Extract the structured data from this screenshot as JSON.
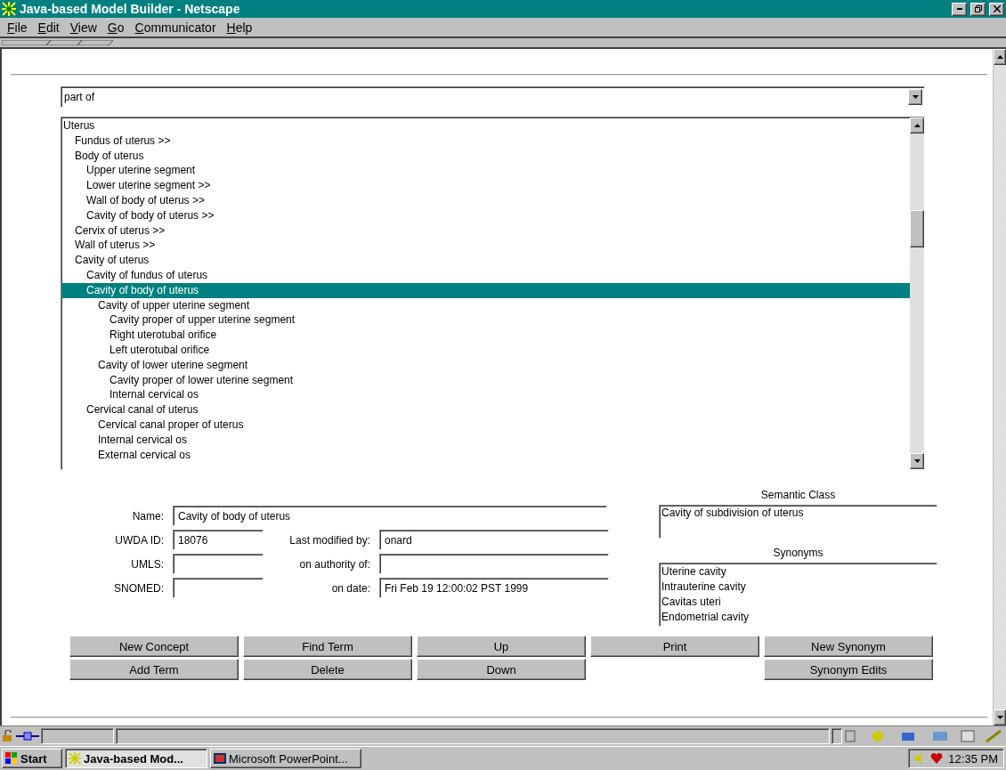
{
  "window": {
    "title": "Java-based Model Builder - Netscape"
  },
  "menu": [
    "File",
    "Edit",
    "View",
    "Go",
    "Communicator",
    "Help"
  ],
  "relation": {
    "value": "part of"
  },
  "tree": [
    {
      "label": "Uterus",
      "selected": false,
      "children": [
        {
          "label": "Fundus of uterus >>",
          "selected": false
        },
        {
          "label": "Body of uterus",
          "selected": false,
          "children": [
            {
              "label": "Upper uterine segment",
              "selected": false
            },
            {
              "label": "Lower uterine segment >>",
              "selected": false
            },
            {
              "label": "Wall of body of uterus >>",
              "selected": false
            },
            {
              "label": "Cavity of body of uterus >>",
              "selected": false
            }
          ]
        },
        {
          "label": "Cervix of uterus >>",
          "selected": false
        },
        {
          "label": "Wall of uterus >>",
          "selected": false
        },
        {
          "label": "Cavity of uterus",
          "selected": false,
          "children": [
            {
              "label": "Cavity of fundus of uterus",
              "selected": false
            },
            {
              "label": "Cavity of body of uterus",
              "selected": true,
              "children": [
                {
                  "label": "Cavity of upper uterine segment",
                  "selected": false,
                  "children": [
                    {
                      "label": "Cavity proper of upper uterine segment",
                      "selected": false
                    },
                    {
                      "label": "Right uterotubal orifice",
                      "selected": false
                    },
                    {
                      "label": "Left uterotubal orifice",
                      "selected": false
                    }
                  ]
                },
                {
                  "label": "Cavity of lower uterine segment",
                  "selected": false,
                  "children": [
                    {
                      "label": "Cavity proper of lower uterine segment",
                      "selected": false
                    },
                    {
                      "label": "Internal cervical os",
                      "selected": false
                    }
                  ]
                }
              ]
            },
            {
              "label": "Cervical canal of uterus",
              "selected": false,
              "children": [
                {
                  "label": "Cervical canal proper of uterus",
                  "selected": false
                },
                {
                  "label": "Internal cervical os",
                  "selected": false
                },
                {
                  "label": "External cervical os",
                  "selected": false
                }
              ]
            }
          ]
        }
      ]
    }
  ],
  "form": {
    "name": {
      "label": "Name:",
      "value": "Cavity of body of uterus"
    },
    "left": [
      {
        "label": "UWDA ID:",
        "value": "18076"
      },
      {
        "label": "UMLS:"
      },
      {
        "label": "SNOMED:"
      }
    ],
    "right": [
      {
        "label": "Last modified by:",
        "value": "onard"
      },
      {
        "label": "on authority of:"
      },
      {
        "label": "on date:",
        "value": "Fri Feb 19 12:00:02 PST 1999"
      }
    ]
  },
  "semantic_class": {
    "title": "Semantic Class",
    "value": "Cavity of subdivision of uterus"
  },
  "synonyms": {
    "title": "Synonyms",
    "items": [
      "Uterine cavity",
      "Intrauterine cavity",
      "Cavitas uteri",
      "Endometrial cavity"
    ]
  },
  "button_columns": [
    [
      "New Concept",
      "Add Term"
    ],
    [
      "Find Term",
      "Delete"
    ],
    [
      "Up",
      "Down"
    ],
    [
      "Print"
    ],
    [
      "New Synonym",
      "Synonym Edits"
    ]
  ],
  "taskbar": {
    "start": "Start",
    "tasks": [
      {
        "label": "Java-based Mod...",
        "selected": true
      },
      {
        "label": "Microsoft PowerPoint...",
        "selected": false
      }
    ],
    "clock": "12:35 PM"
  }
}
